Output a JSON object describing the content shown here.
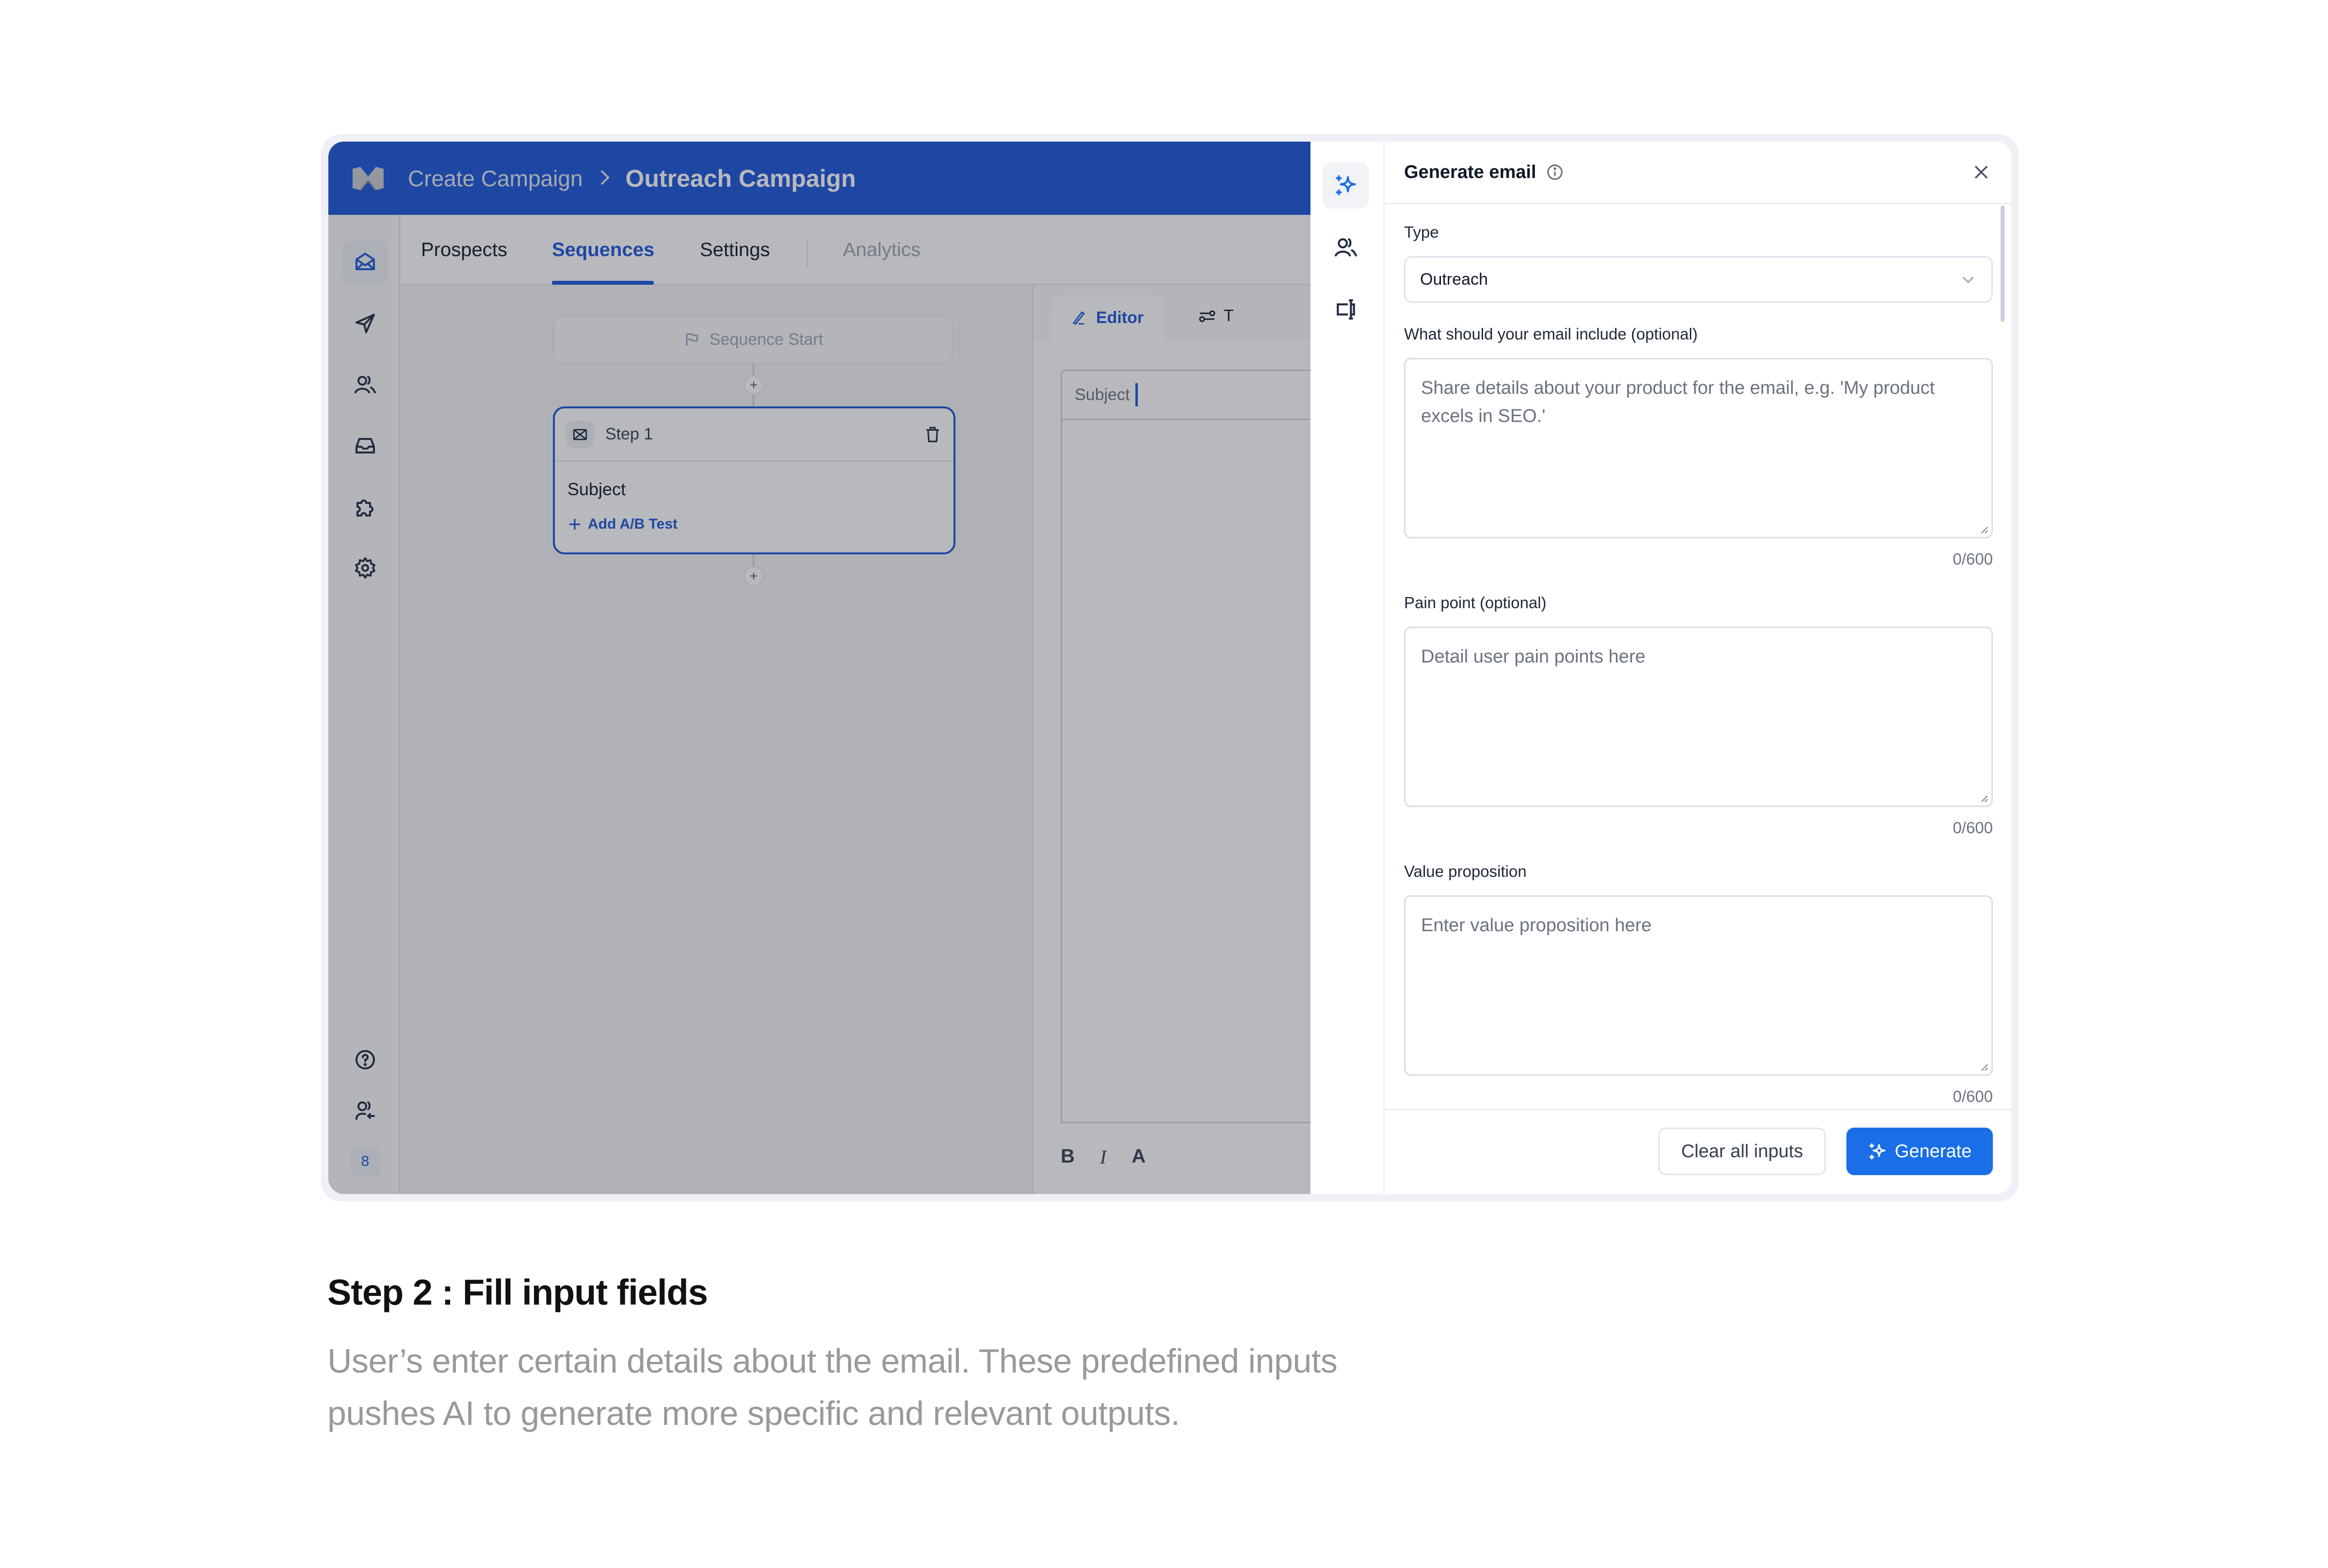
{
  "header": {
    "breadcrumb_parent": "Create Campaign",
    "breadcrumb_separator": ">",
    "breadcrumb_current": "Outreach Campaign"
  },
  "rail": {
    "items": [
      {
        "icon": "mail-open-icon",
        "active": true
      },
      {
        "icon": "send-icon"
      },
      {
        "icon": "users-icon"
      },
      {
        "icon": "inbox-icon"
      },
      {
        "icon": "puzzle-icon"
      },
      {
        "icon": "settings-icon"
      }
    ],
    "bottom": [
      {
        "icon": "help-icon"
      },
      {
        "icon": "user-switch-icon"
      }
    ],
    "badge": "8"
  },
  "tabs": [
    {
      "label": "Prospects"
    },
    {
      "label": "Sequences",
      "active": true
    },
    {
      "label": "Settings"
    },
    {
      "label": "Analytics",
      "disabled": true
    }
  ],
  "sequence": {
    "start_label": "Sequence Start",
    "steps": [
      {
        "title": "Step 1",
        "subject": "Subject",
        "ab_test_label": "Add A/B Test"
      }
    ]
  },
  "editor": {
    "tab_editor": "Editor",
    "tab_second_partial": "T",
    "subject_placeholder": "Subject",
    "format_buttons": [
      "B",
      "I",
      "A"
    ]
  },
  "panel": {
    "title": "Generate email",
    "strip": [
      {
        "icon": "sparkles-icon",
        "active": true
      },
      {
        "icon": "users-icon"
      },
      {
        "icon": "text-input-icon"
      }
    ],
    "type": {
      "label": "Type",
      "value": "Outreach"
    },
    "fields": [
      {
        "label": "What should your email include (optional)",
        "placeholder": "Share details about your product for the email, e.g. 'My product excels in SEO.'",
        "value": "",
        "counter": "0/600"
      },
      {
        "label": "Pain point (optional)",
        "placeholder": "Detail user pain points here",
        "value": "",
        "counter": "0/600"
      },
      {
        "label": "Value proposition",
        "placeholder": "Enter value proposition here",
        "value": "",
        "counter": "0/600"
      }
    ],
    "clear_label": "Clear all inputs",
    "generate_label": "Generate"
  },
  "caption": {
    "title": "Step 2 : Fill input fields",
    "body": "User’s enter certain details about the email. These predefined inputs pushes AI to generate more specific and relevant outputs."
  },
  "colors": {
    "brand_header": "#1a56db",
    "primary_button": "#1a6fe8",
    "active_tab": "#1a56db"
  }
}
